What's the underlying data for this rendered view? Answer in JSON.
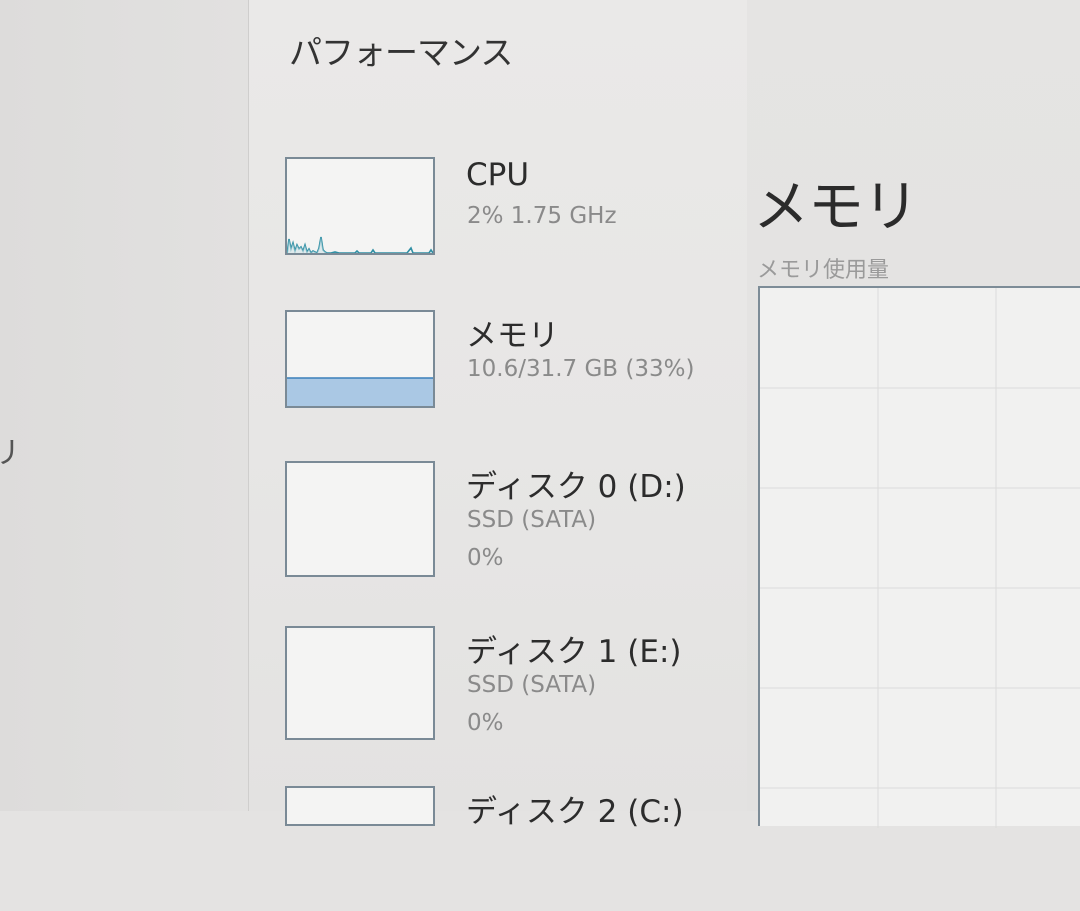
{
  "left_nav": {
    "partial_label": "リ"
  },
  "performance": {
    "title": "パフォーマンス",
    "items": [
      {
        "name": "CPU",
        "sub": "2%  1.75 GHz",
        "sub2": ""
      },
      {
        "name": "メモリ",
        "sub": "10.6/31.7 GB (33%)",
        "sub2": "",
        "usage_fraction": 0.33
      },
      {
        "name": "ディスク 0 (D:)",
        "sub": "SSD (SATA)",
        "sub2": "0%"
      },
      {
        "name": "ディスク 1 (E:)",
        "sub": "SSD (SATA)",
        "sub2": "0%"
      },
      {
        "name": "ディスク 2 (C:)",
        "sub": "",
        "sub2": ""
      }
    ]
  },
  "detail": {
    "title": "メモリ",
    "subtitle": "メモリ使用量"
  },
  "colors": {
    "cpu_line": "#2f8fa4",
    "memory_line": "#3a7fb9",
    "memory_fill": "#aac8e4",
    "graph_border": "#7a8a96"
  },
  "icons": []
}
